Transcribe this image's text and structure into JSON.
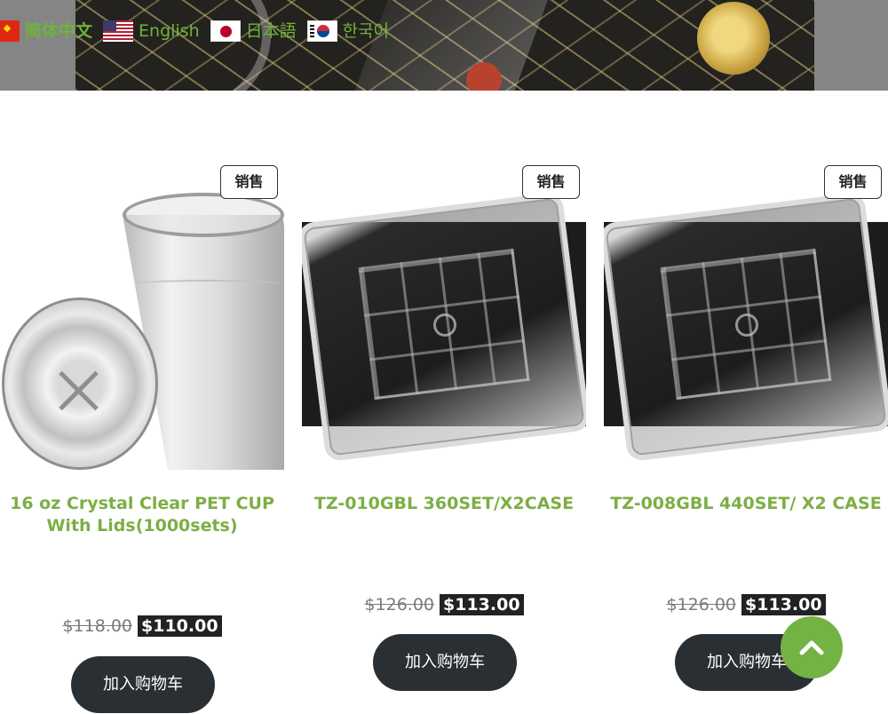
{
  "languages": [
    {
      "label": "简体中文",
      "flag": "china-flag-icon",
      "active": true
    },
    {
      "label": "English",
      "flag": "us-flag-icon",
      "active": false
    },
    {
      "label": "日本語",
      "flag": "japan-flag-icon",
      "active": false
    },
    {
      "label": "한국어",
      "flag": "korea-flag-icon",
      "active": false
    }
  ],
  "products": [
    {
      "badge": "销售",
      "title": "16 oz Crystal Clear PET CUP With Lids(1000sets)",
      "old_price": "$118.00",
      "price": "$110.00",
      "cart_label": "加入购物车"
    },
    {
      "badge": "销售",
      "title": "TZ-010GBL 360SET/X2CASE",
      "old_price": "$126.00",
      "price": "$113.00",
      "cart_label": "加入购物车"
    },
    {
      "badge": "销售",
      "title": "TZ-008GBL 440SET/ X2 CASE",
      "old_price": "$126.00",
      "price": "$113.00",
      "cart_label": "加入购物车"
    }
  ],
  "colors": {
    "accent_green": "#73b344",
    "title_green": "#7dae44",
    "button_dark": "#2a2f33"
  },
  "back_to_top": {
    "icon": "chevron-up-icon"
  }
}
